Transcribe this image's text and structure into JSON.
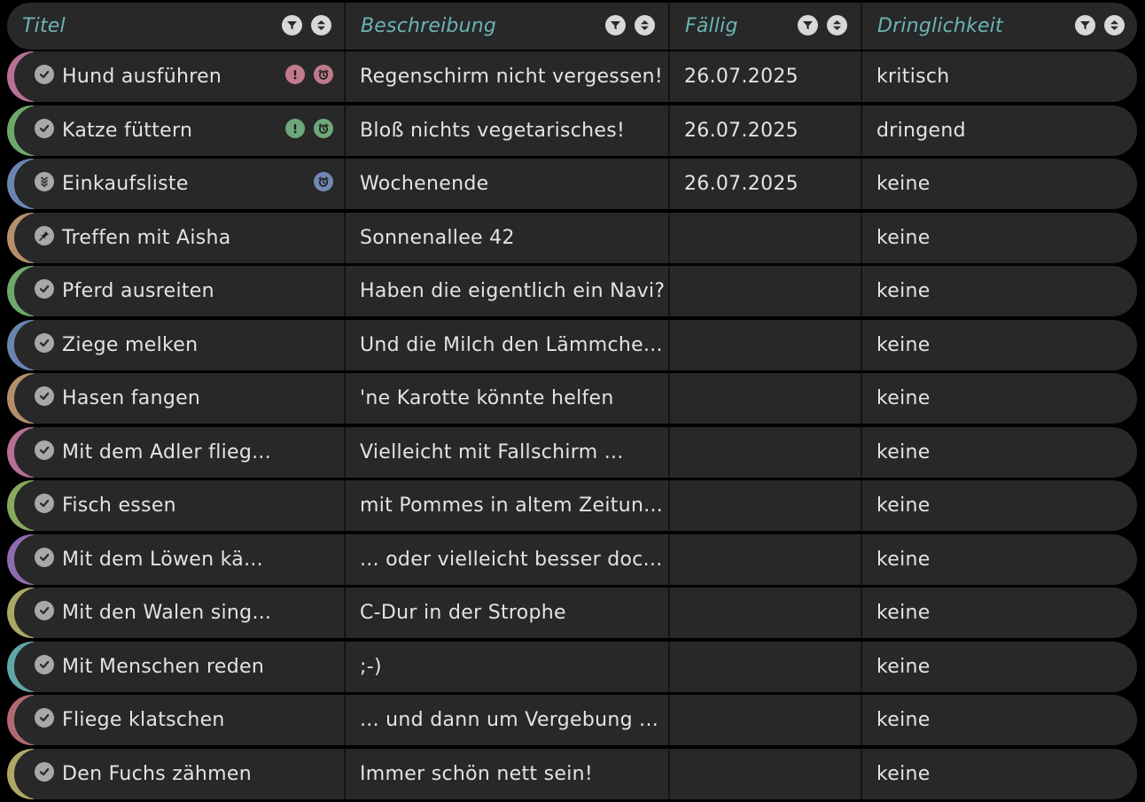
{
  "header": {
    "columns": [
      {
        "label": "Titel"
      },
      {
        "label": "Beschreibung"
      },
      {
        "label": "Fällig"
      },
      {
        "label": "Dringlichkeit"
      }
    ]
  },
  "rows": [
    {
      "title": "Hund ausführen",
      "description": "Regenschirm nicht vergessen!",
      "due": "26.07.2025",
      "urgency": "kritisch",
      "accent": "#b86f94",
      "status_icon": "check-circle-icon",
      "badges": [
        {
          "icon": "exclamation-icon",
          "color": "#c07a8c"
        },
        {
          "icon": "alarm-clock-icon",
          "color": "#c07a8c"
        }
      ]
    },
    {
      "title": "Katze füttern",
      "description": "Bloß nichts vegetarisches!",
      "due": "26.07.2025",
      "urgency": "dringend",
      "accent": "#6fa86b",
      "status_icon": "check-circle-icon",
      "badges": [
        {
          "icon": "exclamation-icon",
          "color": "#6ea77a"
        },
        {
          "icon": "alarm-clock-icon",
          "color": "#6ea77a"
        }
      ]
    },
    {
      "title": "Einkaufsliste",
      "description": "Wochenende",
      "due": "26.07.2025",
      "urgency": "keine",
      "accent": "#6a85b0",
      "status_icon": "list-chevrons-icon",
      "badges": [
        {
          "icon": "alarm-clock-icon",
          "color": "#7287b3"
        }
      ]
    },
    {
      "title": "Treffen mit Aisha",
      "description": "Sonnenallee 42",
      "due": "",
      "urgency": "keine",
      "accent": "#b48f6c",
      "status_icon": "pin-icon",
      "badges": []
    },
    {
      "title": "Pferd ausreiten",
      "description": "Haben die eigentlich ein Navi?",
      "due": "",
      "urgency": "keine",
      "accent": "#6fa86b",
      "status_icon": "check-circle-icon",
      "badges": []
    },
    {
      "title": "Ziege melken",
      "description": "Und die Milch den Lämmche...",
      "due": "",
      "urgency": "keine",
      "accent": "#6a85b0",
      "status_icon": "check-circle-icon",
      "badges": []
    },
    {
      "title": "Hasen fangen",
      "description": "'ne Karotte könnte helfen",
      "due": "",
      "urgency": "keine",
      "accent": "#b48f6c",
      "status_icon": "check-circle-icon",
      "badges": []
    },
    {
      "title": "Mit dem Adler flieg...",
      "description": "Vielleicht mit Fallschirm ...",
      "due": "",
      "urgency": "keine",
      "accent": "#b86f94",
      "status_icon": "check-circle-icon",
      "badges": []
    },
    {
      "title": "Fisch essen",
      "description": "mit Pommes in altem Zeitun...",
      "due": "",
      "urgency": "keine",
      "accent": "#88aa5f",
      "status_icon": "check-circle-icon",
      "badges": []
    },
    {
      "title": "Mit dem Löwen kä...",
      "description": "... oder vielleicht besser doc...",
      "due": "",
      "urgency": "keine",
      "accent": "#8e6cb0",
      "status_icon": "check-circle-icon",
      "badges": []
    },
    {
      "title": "Mit den Walen sing...",
      "description": "C-Dur in der Strophe",
      "due": "",
      "urgency": "keine",
      "accent": "#aaa865",
      "status_icon": "check-circle-icon",
      "badges": []
    },
    {
      "title": "Mit Menschen reden",
      "description": ";-)",
      "due": "",
      "urgency": "keine",
      "accent": "#5fa6a8",
      "status_icon": "check-circle-icon",
      "badges": []
    },
    {
      "title": "Fliege klatschen",
      "description": "... und dann um Vergebung ...",
      "due": "",
      "urgency": "keine",
      "accent": "#b06a6f",
      "status_icon": "check-circle-icon",
      "badges": []
    },
    {
      "title": "Den Fuchs zähmen",
      "description": "Immer schön nett sein!",
      "due": "",
      "urgency": "keine",
      "accent": "#b0a765",
      "status_icon": "check-circle-icon",
      "badges": []
    }
  ]
}
